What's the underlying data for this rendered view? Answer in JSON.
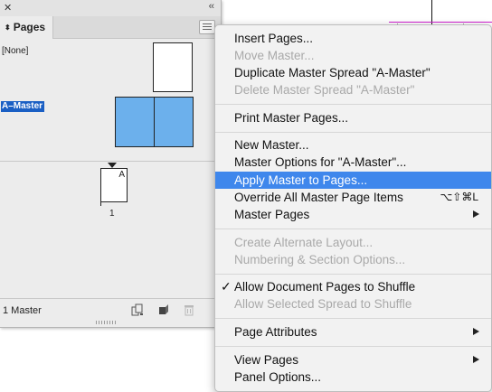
{
  "panel": {
    "tab_label": "Pages",
    "masters": [
      {
        "label": "[None]",
        "selected": false
      },
      {
        "label": "A–Master",
        "selected": true
      }
    ],
    "page": {
      "prefix": "A",
      "number": "1"
    },
    "status": "1 Master"
  },
  "menu": {
    "items": [
      {
        "label": "Insert Pages...",
        "enabled": true
      },
      {
        "label": "Move Master...",
        "enabled": false
      },
      {
        "label": "Duplicate Master Spread \"A-Master\"",
        "enabled": true
      },
      {
        "label": "Delete Master Spread \"A-Master\"",
        "enabled": false
      },
      {
        "label": "Print Master Pages...",
        "enabled": true
      },
      {
        "label": "New Master...",
        "enabled": true
      },
      {
        "label": "Master Options for \"A-Master\"...",
        "enabled": true
      },
      {
        "label": "Apply Master to Pages...",
        "enabled": true,
        "highlighted": true
      },
      {
        "label": "Override All Master Page Items",
        "enabled": true,
        "shortcut": "⌥⇧⌘L"
      },
      {
        "label": "Master Pages",
        "enabled": true,
        "submenu": true
      },
      {
        "label": "Create Alternate Layout...",
        "enabled": false
      },
      {
        "label": "Numbering & Section Options...",
        "enabled": false
      },
      {
        "label": "Allow Document Pages to Shuffle",
        "enabled": true,
        "checked": true
      },
      {
        "label": "Allow Selected Spread to Shuffle",
        "enabled": false
      },
      {
        "label": "Page Attributes",
        "enabled": true,
        "submenu": true
      },
      {
        "label": "View Pages",
        "enabled": true,
        "submenu": true
      },
      {
        "label": "Panel Options...",
        "enabled": true
      }
    ]
  },
  "colors": {
    "highlight": "#3f87ec",
    "selection": "#1a5fc4",
    "master_thumb": "#6cb0ec",
    "margin_guide": "#d020d0"
  },
  "icons": [
    "close-icon",
    "collapse-icon",
    "panel-menu-icon",
    "sort-icon",
    "new-page-icon",
    "delete-page-icon",
    "checkmark-icon",
    "submenu-arrow-icon"
  ]
}
